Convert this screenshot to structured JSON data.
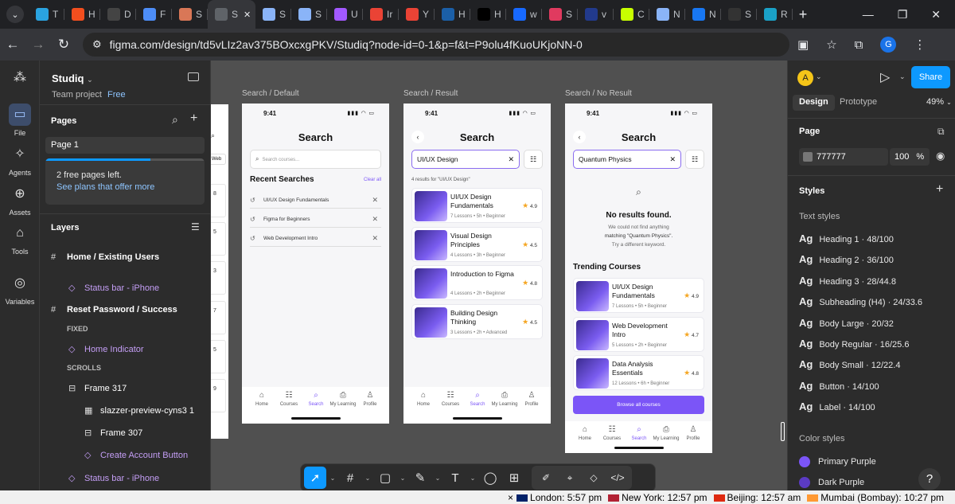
{
  "browser": {
    "tabs_menu_icon": "chevron-down-icon",
    "tabs": [
      {
        "icon": "telegram",
        "label": "T",
        "color": "#2aa3e0"
      },
      {
        "icon": "figma",
        "label": "H",
        "color": "#f24e1e"
      },
      {
        "icon": "chatgpt",
        "label": "D",
        "color": "#444444"
      },
      {
        "icon": "gemini",
        "label": "F",
        "color": "#4d8df7"
      },
      {
        "icon": "claude",
        "label": "S",
        "color": "#d97757"
      },
      {
        "icon": "active",
        "label": "S",
        "color": "#5f6368",
        "active": true
      },
      {
        "icon": "globe",
        "label": "S",
        "color": "#8ab4f8"
      },
      {
        "icon": "globe",
        "label": "S",
        "color": "#8ab4f8"
      },
      {
        "icon": "figma",
        "label": "U",
        "color": "#a259ff"
      },
      {
        "icon": "gmail",
        "label": "Ir",
        "color": "#ea4335"
      },
      {
        "icon": "gmail",
        "label": "Y",
        "color": "#ea4335"
      },
      {
        "icon": "upwork",
        "label": "H",
        "color": "#1b5fa7"
      },
      {
        "icon": "x",
        "label": "H",
        "color": "#000000"
      },
      {
        "icon": "behance",
        "label": "w",
        "color": "#1769ff"
      },
      {
        "icon": "pinwheel",
        "label": "S",
        "color": "#e03a5f"
      },
      {
        "icon": "tl",
        "label": "v",
        "color": "#223a8c"
      },
      {
        "icon": "n",
        "label": "C",
        "color": "#c8ff00"
      },
      {
        "icon": "globe",
        "label": "N",
        "color": "#8ab4f8"
      },
      {
        "icon": "meta",
        "label": "N",
        "color": "#1877f2"
      },
      {
        "icon": "s",
        "label": "S",
        "color": "#333333"
      },
      {
        "icon": "r",
        "label": "R",
        "color": "#1aa1c7"
      }
    ],
    "url": "figma.com/design/td5vLIz2av375BOxcxgPKV/Studiq?node-id=0-1&p=f&t=P9olu4fKuoUKjoNN-0",
    "profile_initial": "G"
  },
  "figma": {
    "project_name": "Studiq",
    "team_label": "Team project",
    "plan_badge": "Free",
    "rail": [
      {
        "label": "File",
        "icon": "file-icon"
      },
      {
        "label": "Agents",
        "icon": "agents-icon"
      },
      {
        "label": "Assets",
        "icon": "assets-icon"
      },
      {
        "label": "Tools",
        "icon": "tools-icon"
      },
      {
        "label": "Variables",
        "icon": "variables-icon"
      }
    ],
    "pages_heading": "Pages",
    "current_page": "Page 1",
    "pages_notice": "2 free pages left.",
    "pages_link": "See plans that offer more",
    "layers_heading": "Layers",
    "layers": [
      {
        "label": "Home / Existing Users",
        "kind": "frame"
      },
      {
        "label": "Status bar - iPhone",
        "kind": "component"
      },
      {
        "label": "Reset Password / Success",
        "kind": "frame"
      },
      {
        "label": "FIXED",
        "kind": "section"
      },
      {
        "label": "Home Indicator",
        "kind": "component"
      },
      {
        "label": "SCROLLS",
        "kind": "section"
      },
      {
        "label": "Frame 317",
        "kind": "group"
      },
      {
        "label": "slazzer-preview-cyns3 1",
        "kind": "image"
      },
      {
        "label": "Frame 307",
        "kind": "group"
      },
      {
        "label": "Create Account Button",
        "kind": "component"
      },
      {
        "label": "Status bar - iPhone",
        "kind": "component"
      }
    ]
  },
  "canvas": {
    "frames": [
      {
        "label": "Search / Default"
      },
      {
        "label": "Search / Result"
      },
      {
        "label": "Search / No Result"
      }
    ],
    "partial_frame_numbers": [
      "8",
      "5",
      "3",
      "7",
      "5",
      "9"
    ],
    "partial_frame_tab": "Web",
    "status_time": "9:41",
    "screen_title": "Search",
    "default": {
      "placeholder": "Search courses...",
      "recent_heading": "Recent Searches",
      "clear_all": "Clear all",
      "recent": [
        "UI/UX Design Fundamentals",
        "Figma for Beginners",
        "Web Development Intro"
      ]
    },
    "result": {
      "query": "UI/UX Design",
      "count_text": "4 results for \"UI/UX Design\"",
      "cards": [
        {
          "title": "UI/UX Design Fundamentals",
          "meta": "7 Lessons • 5h • Beginner",
          "rating": "4.9"
        },
        {
          "title": "Visual Design Principles",
          "meta": "4 Lessons • 3h • Beginner",
          "rating": "4.5"
        },
        {
          "title": "Introduction to Figma",
          "meta": "4 Lessons • 2h • Beginner",
          "rating": "4.8"
        },
        {
          "title": "Building Design Thinking",
          "meta": "3 Lessons • 2h • Advanced",
          "rating": "4.5"
        }
      ]
    },
    "no_result": {
      "query": "Quantum Physics",
      "heading": "No results found.",
      "line1": "We could not find anything",
      "line2": "matching \"Quantum Physics\".",
      "line3": "Try a different keyword.",
      "trending_heading": "Trending Courses",
      "cards": [
        {
          "title": "UI/UX Design Fundamentals",
          "meta": "7 Lessons • 5h • Beginner",
          "rating": "4.9"
        },
        {
          "title": "Web Development Intro",
          "meta": "5 Lessons • 2h • Beginner",
          "rating": "4.7"
        },
        {
          "title": "Data Analysis Essentials",
          "meta": "12 Lessons • 6h • Beginner",
          "rating": "4.8"
        }
      ],
      "browse_button": "Browse all courses"
    },
    "nav": [
      "Home",
      "Courses",
      "Search",
      "My Learning",
      "Profile"
    ]
  },
  "right_panel": {
    "user_initial": "A",
    "share_label": "Share",
    "tab_design": "Design",
    "tab_prototype": "Prototype",
    "zoom": "49%",
    "page_heading": "Page",
    "page_color": "777777",
    "page_color_hex": "#777777",
    "page_opacity": "100",
    "percent_sign": "%",
    "styles_heading": "Styles",
    "text_styles_heading": "Text styles",
    "ag": "Ag",
    "text_styles": [
      "Heading 1 · 48/100",
      "Heading 2 · 36/100",
      "Heading 3 · 28/44.8",
      "Subheading (H4) · 24/33.6",
      "Body Large · 20/32",
      "Body Regular · 16/25.6",
      "Body Small · 12/22.4",
      "Button · 14/100",
      "Label · 14/100"
    ],
    "color_styles_heading": "Color styles",
    "color_styles": [
      {
        "name": "Primary Purple",
        "hex": "#7b55f7"
      },
      {
        "name": "Dark Purple",
        "hex": "#5b3bc4"
      }
    ],
    "help": "?"
  },
  "toolbar": {
    "tools": [
      {
        "name": "move-tool",
        "glyph": "➚",
        "selected": true
      },
      {
        "name": "frame-tool",
        "glyph": "#"
      },
      {
        "name": "shape-tool",
        "glyph": "▢"
      },
      {
        "name": "pen-tool",
        "glyph": "✎"
      },
      {
        "name": "text-tool",
        "glyph": "T"
      },
      {
        "name": "comment-tool",
        "glyph": "◯"
      },
      {
        "name": "actions-tool",
        "glyph": "⊞"
      }
    ],
    "group": [
      {
        "name": "draw-mode",
        "glyph": "✐"
      },
      {
        "name": "design-mode",
        "glyph": "⌖"
      },
      {
        "name": "component-mode",
        "glyph": "◇"
      },
      {
        "name": "dev-mode",
        "glyph": "</>"
      }
    ]
  },
  "taskbar": {
    "clocks": [
      {
        "city": "London: 5:57 pm",
        "flag": "#012169"
      },
      {
        "city": "New York: 12:57 pm",
        "flag": "#b22234"
      },
      {
        "city": "Beijing: 12:57 am",
        "flag": "#de2910"
      },
      {
        "city": "Mumbai (Bombay): 10:27 pm",
        "flag": "#ff9933"
      }
    ],
    "close_glyph": "×"
  },
  "colors": {
    "accent": "#7b55f7",
    "figma_blue": "#0d99ff",
    "star": "#f5a623"
  }
}
